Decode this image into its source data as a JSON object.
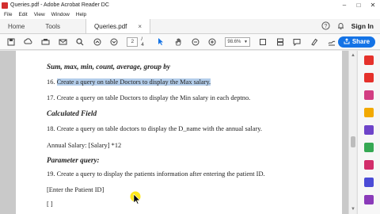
{
  "window": {
    "title": "Queries.pdf - Adobe Acrobat Reader DC",
    "controls": [
      "–",
      "□",
      "✕"
    ]
  },
  "menu": [
    "File",
    "Edit",
    "View",
    "Window",
    "Help"
  ],
  "tabs": {
    "home": "Home",
    "tools": "Tools",
    "document": "Queries.pdf",
    "close": "×"
  },
  "header": {
    "sign_in": "Sign In"
  },
  "toolbar": {
    "current_page": "2",
    "total_pages": "/ 4",
    "zoom": "98.6%",
    "share": "Share"
  },
  "document": {
    "heading1": "Sum, max, min, count, average, group by",
    "q16_num": "16.",
    "q16_text": "Create  a query on table Doctors to display the Max salary.",
    "q17": "17. Create a query on table Doctors to display the Min salary in each deptno.",
    "heading2": "Calculated Field",
    "q18": "18. Create a query on table doctors to display the D_name with the annual salary.",
    "annual": "Annual Salary: [Salary] *12",
    "heading3": "Parameter query:",
    "q19": "19. Create a query to display the patients information after entering the patient ID.",
    "param": "[Enter the Patient ID]",
    "brackets": "[ ]"
  },
  "colors": {
    "share_button": "#1473e6",
    "highlight": "#b3cdea",
    "cursor_yellow": "#ffe600"
  },
  "right_panel_icons": [
    {
      "name": "export-pdf-icon",
      "color": "#e5312b"
    },
    {
      "name": "create-pdf-icon",
      "color": "#e5312b"
    },
    {
      "name": "edit-pdf-icon",
      "color": "#d23d82"
    },
    {
      "name": "comment-icon",
      "color": "#f2a900"
    },
    {
      "name": "combine-files-icon",
      "color": "#6e44c9"
    },
    {
      "name": "organize-pages-icon",
      "color": "#35a853"
    },
    {
      "name": "redact-icon",
      "color": "#d22d6a"
    },
    {
      "name": "protect-icon",
      "color": "#4b4bd6"
    },
    {
      "name": "fill-sign-icon",
      "color": "#8a3ab9"
    }
  ]
}
